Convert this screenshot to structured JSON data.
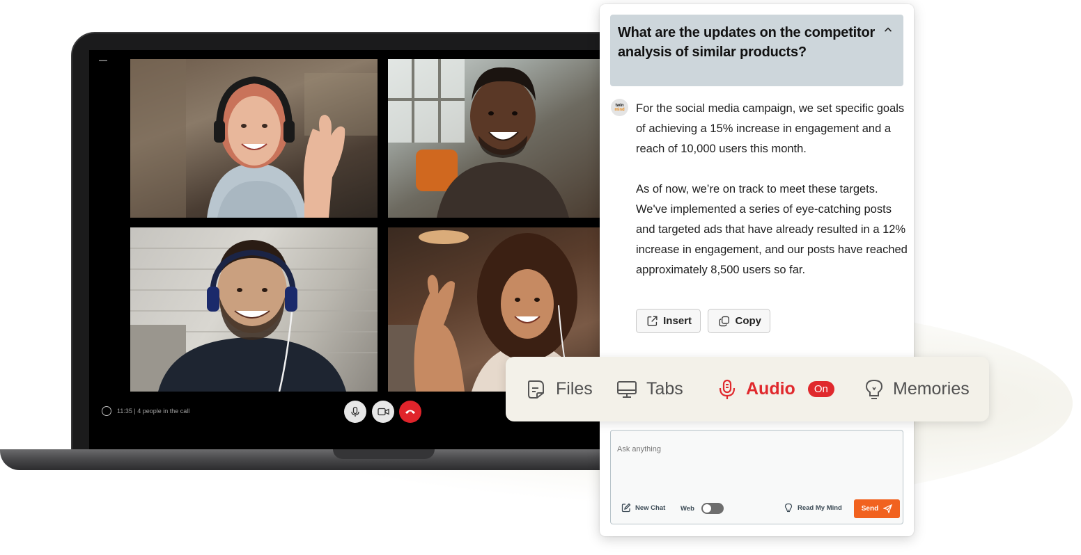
{
  "video_call": {
    "status_text": "11:35 | 4 people in the call",
    "participants": [
      {
        "label": "participant-1"
      },
      {
        "label": "participant-2"
      },
      {
        "label": "participant-3"
      },
      {
        "label": "participant-4"
      }
    ],
    "controls": [
      "mic-icon",
      "camera-icon",
      "end-call-icon"
    ]
  },
  "assistant": {
    "question": "What are the updates on the competitor analysis of similar products?",
    "avatar_text_top": "twin",
    "avatar_text_bottom": "mind",
    "answer_paragraphs": [
      "For the social media campaign, we set specific goals of achieving a 15% increase in engagement and a reach of 10,000 users this month.",
      "As of now, we’re on track to meet these targets. We've implemented a series of eye-catching posts and targeted ads that have already resulted in a 12% increase in engagement, and our posts have reached approximately 8,500 users so far."
    ],
    "actions": {
      "insert_label": "Insert",
      "copy_label": "Copy"
    }
  },
  "tools": {
    "files_label": "Files",
    "tabs_label": "Tabs",
    "audio_label": "Audio",
    "audio_status": "On",
    "memories_label": "Memories"
  },
  "input": {
    "placeholder": "Ask anything",
    "value": "",
    "new_chat_label": "New Chat",
    "web_label": "Web",
    "web_enabled": false,
    "read_mind_label": "Read My Mind",
    "send_label": "Send"
  },
  "colors": {
    "accent_red": "#e0292d",
    "send_orange": "#f1621f",
    "question_bg": "#cdd6db",
    "tools_bg": "#f3f1e9"
  }
}
